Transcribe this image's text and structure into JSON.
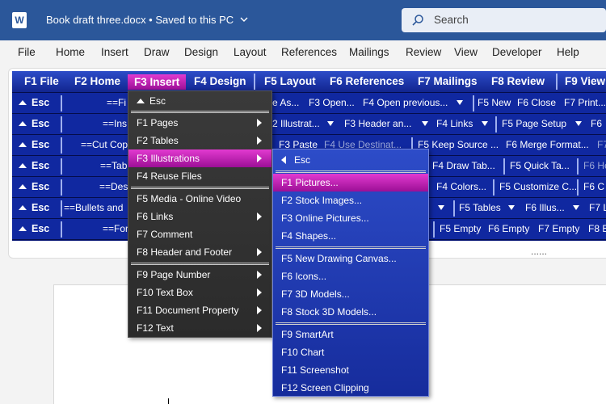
{
  "titlebar": {
    "app_icon": "W",
    "doc_title": "Book draft three.docx • Saved to this PC",
    "search_placeholder": "Search"
  },
  "menubar": {
    "items": [
      "File",
      "Home",
      "Insert",
      "Draw",
      "Design",
      "Layout",
      "References",
      "Mailings",
      "Review",
      "View",
      "Developer",
      "Help"
    ]
  },
  "ribbon": {
    "ellipsis": "......"
  },
  "panel": {
    "tabs": [
      "F1 File",
      "F2 Home",
      "F3 Insert",
      "F4 Design",
      "F5 Layout",
      "F6 References",
      "F7 Mailings",
      "F8 Review",
      "F9 View"
    ],
    "esc": "Esc",
    "rows": [
      {
        "c1": "==Fi",
        "c2": "e As...",
        "c3": "F3 Open...",
        "c4": "F4 Open previous...",
        "c5": "F5 New",
        "c6": "F6 Close",
        "c7": "F7 Print..."
      },
      {
        "c1": "==Ins",
        "c2": "2 Illustrat...",
        "c3": "F3 Header an...",
        "c4": "F4 Links",
        "c5": "F5 Page Setup",
        "c6": "F6"
      },
      {
        "c1": "==Cut Cop",
        "c2": "F3 Paste",
        "c3": "F4 Use Destinat...",
        "c4": "F5 Keep Source ...",
        "c5": "F6 Merge Format...",
        "c6": "F7"
      },
      {
        "c1": "==Tab",
        "c2": "F4 Draw Tab...",
        "c3": "F5 Quick Ta...",
        "c4": "F6 Hea"
      },
      {
        "c1": "==Des",
        "c2": "F4 Colors...",
        "c3": "F5 Customize C...",
        "c4": "F6 C"
      },
      {
        "c1": "==Bullets and",
        "c2": "F5 Tables",
        "c3": "F6 Illus...",
        "c4": "F7 L"
      },
      {
        "c1": "==For",
        "c2": "F5 Empty",
        "c3": "F6 Empty",
        "c4": "F7 Empty",
        "c5": "F8 E"
      }
    ]
  },
  "menu1": {
    "esc": "Esc",
    "items": [
      "F1 Pages",
      "F2 Tables",
      "F3 Illustrations",
      "F4 Reuse Files",
      "F5 Media - Online Video",
      "F6 Links",
      "F7 Comment",
      "F8 Header and Footer",
      "F9 Page Number",
      "F10 Text Box",
      "F11 Document Property",
      "F12 Text"
    ]
  },
  "menu2": {
    "esc": "Esc",
    "items": [
      "F1 Pictures...",
      "F2 Stock Images...",
      "F3 Online Pictures...",
      "F4 Shapes...",
      "F5 New Drawing Canvas...",
      "F6 Icons...",
      "F7 3D Models...",
      "F8 Stock 3D Models...",
      "F9 SmartArt",
      "F10 Chart",
      "F11 Screenshot",
      "F12 Screen Clipping"
    ]
  },
  "colors": {
    "title_bar": "#2b579a",
    "panel_blue": "#1028a0",
    "highlight_magenta": "#c020b8"
  }
}
